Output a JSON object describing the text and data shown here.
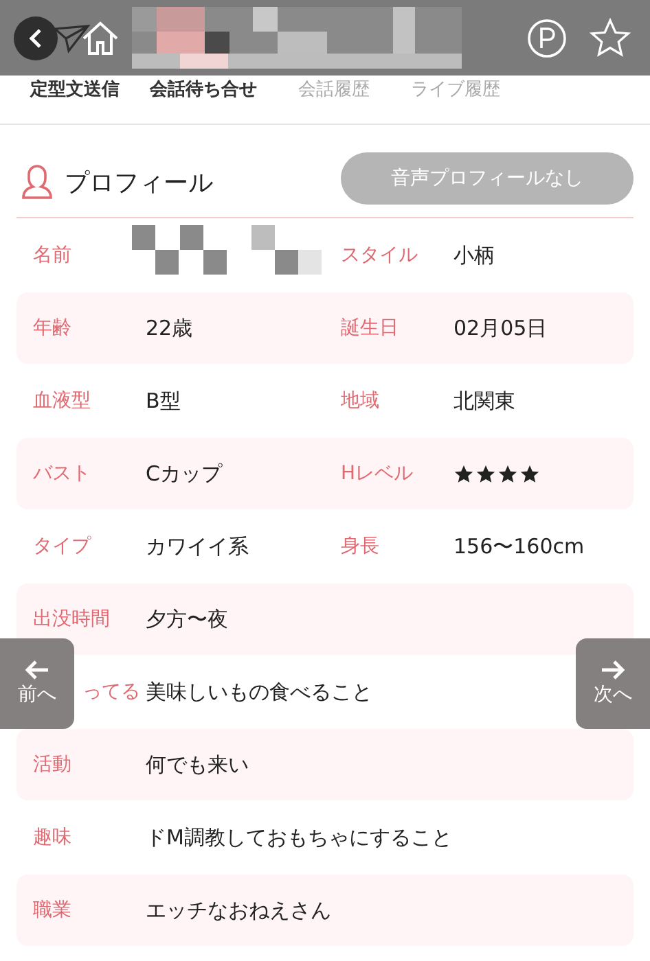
{
  "tabs": [
    {
      "label": "定型文送信",
      "disabled": false
    },
    {
      "label": "会話待ち合せ",
      "disabled": false
    },
    {
      "label": "会話履歴",
      "disabled": true
    },
    {
      "label": "ライブ履歴",
      "disabled": true
    }
  ],
  "profile": {
    "title": "プロフィール",
    "voice_button": "音声プロフィールなし"
  },
  "rows": [
    {
      "fields": [
        {
          "label": "名前",
          "kind": "redacted"
        },
        {
          "label": "スタイル",
          "kind": "text",
          "value": "小柄"
        }
      ]
    },
    {
      "fields": [
        {
          "label": "年齢",
          "kind": "text",
          "value": "22歳"
        },
        {
          "label": "誕生日",
          "kind": "text",
          "value": "02月05日"
        }
      ]
    },
    {
      "fields": [
        {
          "label": "血液型",
          "kind": "text",
          "value": "B型"
        },
        {
          "label": "地域",
          "kind": "text",
          "value": "北関東"
        }
      ]
    },
    {
      "fields": [
        {
          "label": "バスト",
          "kind": "text",
          "value": "Cカップ"
        },
        {
          "label": "Hレベル",
          "kind": "stars",
          "stars": 4
        }
      ]
    },
    {
      "fields": [
        {
          "label": "タイプ",
          "kind": "text",
          "value": "カワイイ系"
        },
        {
          "label": "身長",
          "kind": "text",
          "value": "156〜160cm"
        }
      ]
    },
    {
      "fields": [
        {
          "label": "出没時間",
          "kind": "text",
          "value": "夕方〜夜"
        }
      ]
    },
    {
      "fields": [
        {
          "label": "ってる",
          "label_cut": true,
          "kind": "text",
          "value": "美味しいもの食べること"
        }
      ]
    },
    {
      "fields": [
        {
          "label": "活動",
          "kind": "text",
          "value": "何でも来い"
        }
      ]
    },
    {
      "fields": [
        {
          "label": "趣味",
          "kind": "text",
          "value": "ドM調教しておもちゃにすること"
        }
      ]
    },
    {
      "fields": [
        {
          "label": "職業",
          "kind": "text",
          "value": "エッチなおねえさん"
        }
      ]
    }
  ],
  "nav": {
    "prev": "前へ",
    "next": "次へ"
  }
}
